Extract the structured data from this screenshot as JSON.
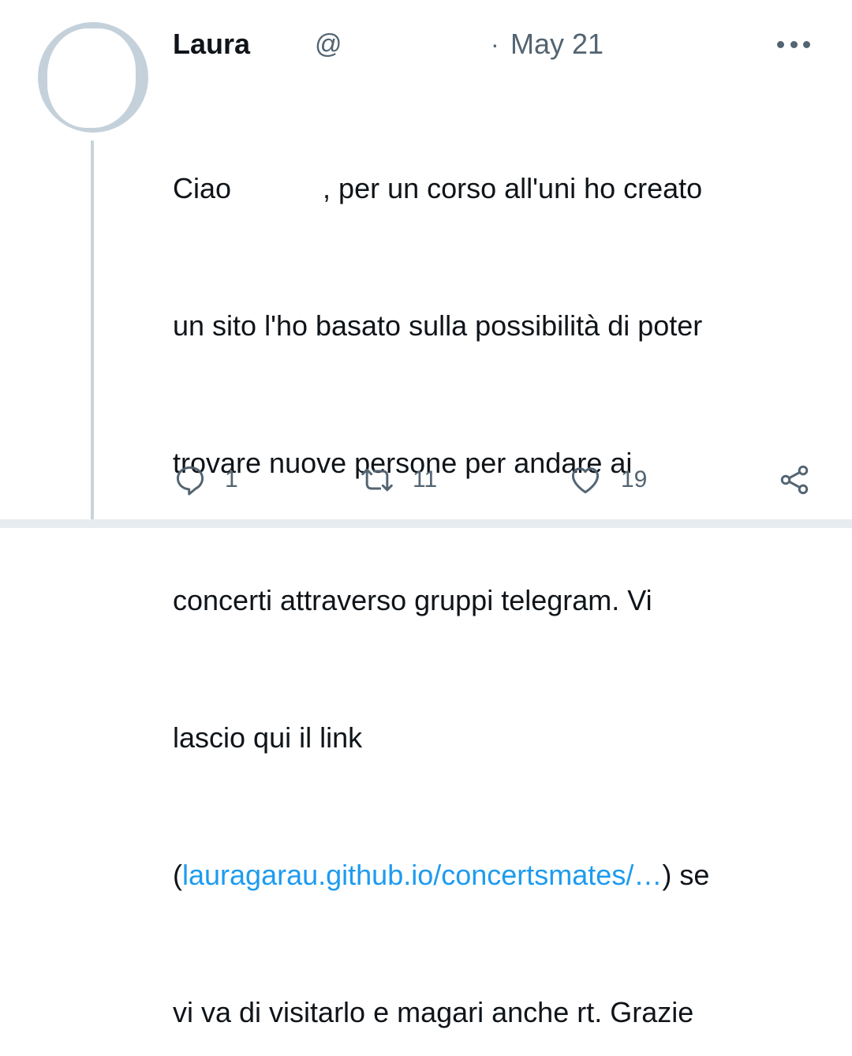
{
  "tweet": {
    "author_name": "Laura",
    "handle": "@",
    "separator": "·",
    "date": "May 21",
    "text_lines": [
      {
        "before": "Ciao",
        "after": ", per un corso all'uni ho creato"
      },
      "un sito l'ho basato sulla possibilità di poter",
      "trovare nuove persone per andare ai",
      "concerti attraverso gruppi telegram. Vi",
      "lascio qui il link",
      {
        "open": "(",
        "link": "lauragarau.github.io/concertsmates/…",
        "close": ") se"
      },
      "vi va di visitarlo e magari anche rt. Grazie"
    ],
    "actions": {
      "reply_count": "1",
      "retweet_count": "11",
      "like_count": "19"
    }
  },
  "icons": {
    "more": "more-horizontal-icon",
    "reply": "reply-icon",
    "retweet": "retweet-icon",
    "like": "heart-icon",
    "share": "share-icon"
  },
  "colors": {
    "link": "#1d9bf0",
    "secondary_text": "#536471",
    "thread_line": "#c9d3db"
  }
}
